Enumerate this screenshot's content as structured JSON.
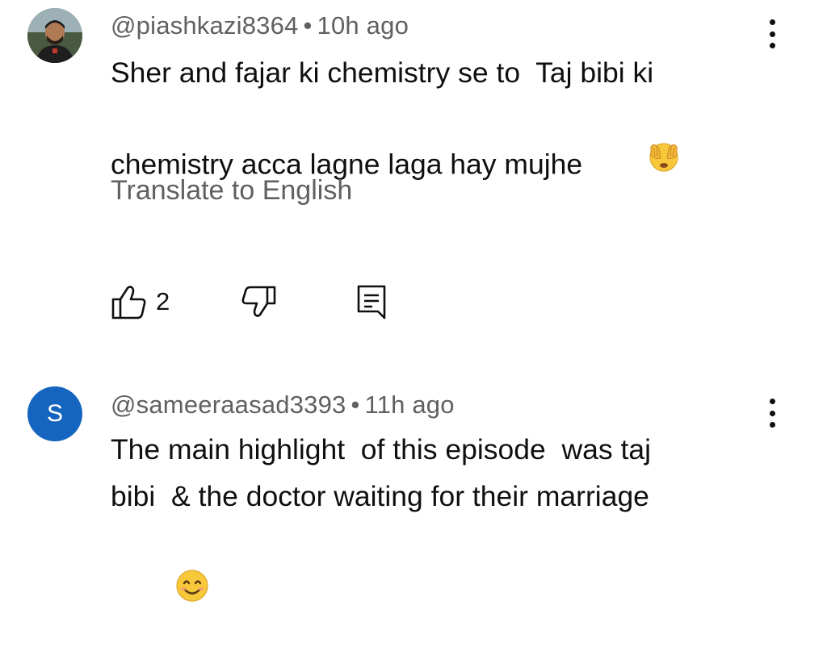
{
  "comments": [
    {
      "avatar_type": "photo",
      "author": "@piashkazi8364",
      "separator": "•",
      "time": "10h ago",
      "text_lines": [
        "Sher and fajar ki chemistry se to  Taj bibi ki",
        "chemistry acca lagne laga hay mujhe"
      ],
      "emoji": "face-with-hands-over-eyes",
      "translate_label": "Translate to English",
      "like_count": "2",
      "icons": {
        "like": "thumbs-up-icon",
        "dislike": "thumbs-down-icon",
        "reply": "reply-comment-icon",
        "menu": "more-vertical-icon"
      }
    },
    {
      "avatar_type": "letter",
      "avatar_letter": "S",
      "avatar_color": "#1565c0",
      "author": "@sameeraasad3393",
      "separator": "•",
      "time": "11h ago",
      "text_lines": [
        "The main highlight  of this episode  was taj",
        "bibi  & the doctor waiting for their marriage"
      ],
      "emoji": "smiling-face-with-smiling-eyes"
    }
  ]
}
